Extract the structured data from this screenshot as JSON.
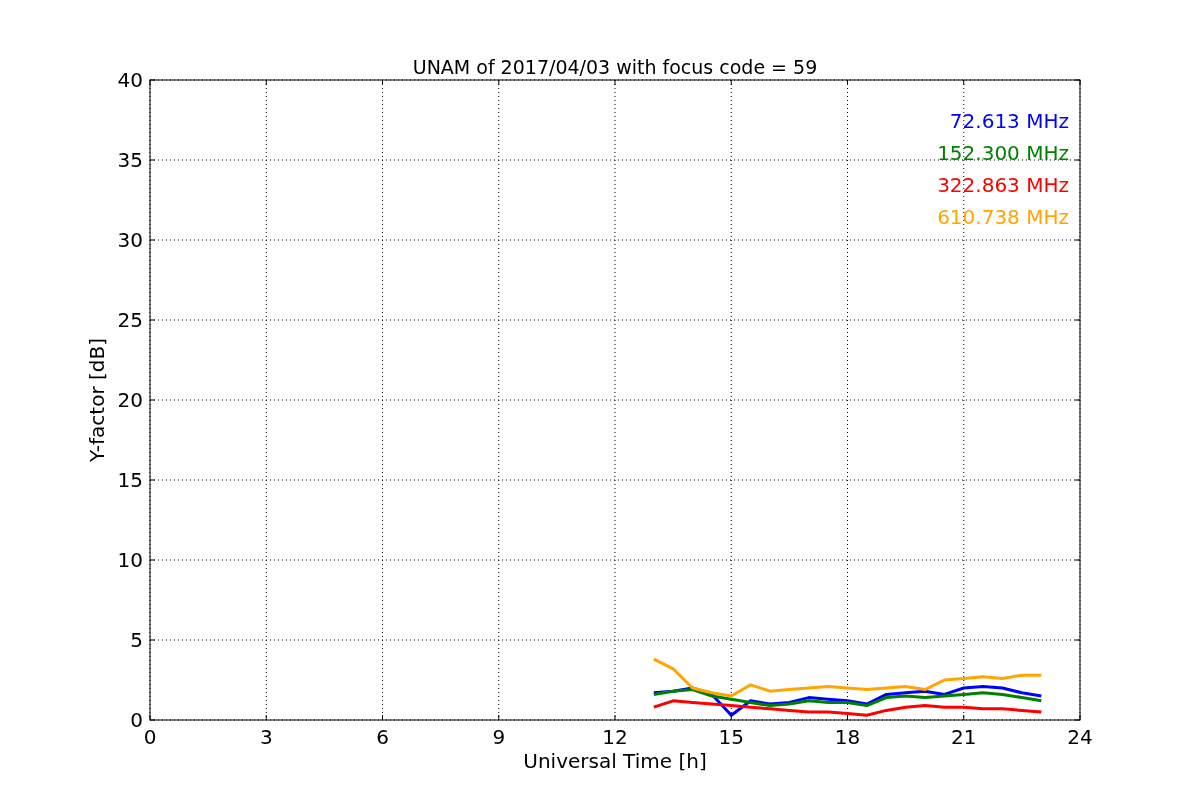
{
  "figure": {
    "chart_data": {
      "type": "line",
      "grid": true,
      "title": "UNAM of 2017/04/03 with focus code = 59",
      "xlabel": "Universal Time [h]",
      "ylabel": "Y-factor [dB]",
      "xlim": [
        0,
        24
      ],
      "ylim": [
        0,
        40
      ],
      "xticks": [
        0,
        3,
        6,
        9,
        12,
        15,
        18,
        21,
        24
      ],
      "yticks": [
        0,
        5,
        10,
        15,
        20,
        25,
        30,
        35,
        40
      ],
      "x": [
        13,
        13.5,
        14,
        14.5,
        15,
        15.5,
        16,
        16.5,
        17,
        17.5,
        18,
        18.5,
        19,
        19.5,
        20,
        20.5,
        21,
        21.5,
        22,
        22.5,
        23
      ],
      "series": [
        {
          "name": "72.613 MHz",
          "color": "#0000ff",
          "values": [
            1.7,
            1.8,
            2.0,
            1.6,
            0.3,
            1.2,
            1.0,
            1.1,
            1.4,
            1.3,
            1.2,
            1.0,
            1.6,
            1.7,
            1.8,
            1.6,
            2.0,
            2.1,
            2.0,
            1.7,
            1.5
          ]
        },
        {
          "name": "152.300 MHz",
          "color": "#008000",
          "values": [
            1.6,
            1.8,
            1.9,
            1.5,
            1.3,
            1.1,
            0.9,
            1.0,
            1.2,
            1.1,
            1.1,
            0.9,
            1.4,
            1.5,
            1.4,
            1.5,
            1.6,
            1.7,
            1.6,
            1.4,
            1.2
          ]
        },
        {
          "name": "322.863 MHz",
          "color": "#ff0000",
          "values": [
            0.8,
            1.2,
            1.1,
            1.0,
            0.9,
            0.8,
            0.7,
            0.6,
            0.5,
            0.5,
            0.4,
            0.3,
            0.6,
            0.8,
            0.9,
            0.8,
            0.8,
            0.7,
            0.7,
            0.6,
            0.5
          ]
        },
        {
          "name": "610.738 MHz",
          "color": "#ffa500",
          "values": [
            3.8,
            3.2,
            2.0,
            1.7,
            1.5,
            2.2,
            1.8,
            1.9,
            2.0,
            2.1,
            2.0,
            1.9,
            2.0,
            2.1,
            1.9,
            2.5,
            2.6,
            2.7,
            2.6,
            2.8,
            2.8
          ]
        }
      ]
    }
  }
}
